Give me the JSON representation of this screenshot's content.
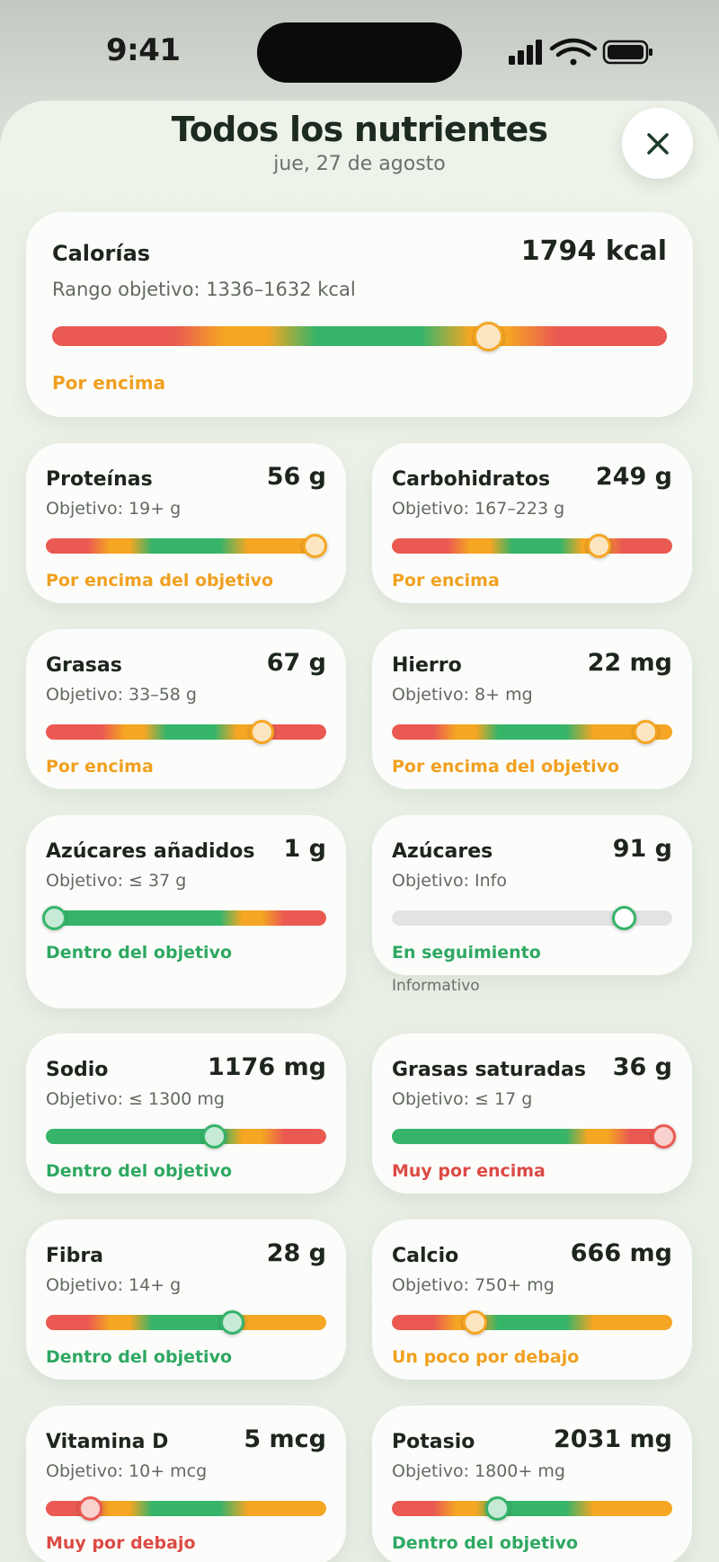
{
  "status_bar": {
    "time": "9:41"
  },
  "header": {
    "title": "Todos los nutrientes",
    "date": "jue, 27 de agosto"
  },
  "colors": {
    "red": "#ea5a52",
    "orange": "#f5a623",
    "green": "#35b46a",
    "grey": "#e3e3e3",
    "status_green": "#2fa862",
    "status_orange": "#f0a020",
    "status_red": "#dd4a44"
  },
  "calories": {
    "name": "Calorías",
    "value": "1794 kcal",
    "target": "Rango objetivo: 1336–1632 kcal",
    "status": "Por encima",
    "status_tone": "orange",
    "gradient": "range",
    "position": 0.71
  },
  "nutrients": [
    {
      "name": "Proteínas",
      "value": "56 g",
      "target": "Objetivo: 19+ g",
      "status": "Por encima del objetivo",
      "status_tone": "orange",
      "gradient": "min",
      "position": 0.96
    },
    {
      "name": "Carbohidratos",
      "value": "249 g",
      "target": "Objetivo: 167–223 g",
      "status": "Por encima",
      "status_tone": "orange",
      "gradient": "range",
      "position": 0.74
    },
    {
      "name": "Grasas",
      "value": "67 g",
      "target": "Objetivo: 33–58 g",
      "status": "Por encima",
      "status_tone": "orange",
      "gradient": "range",
      "position": 0.77
    },
    {
      "name": "Hierro",
      "value": "22 mg",
      "target": "Objetivo: 8+ mg",
      "status": "Por encima del objetivo",
      "status_tone": "orange",
      "gradient": "min",
      "position": 0.905
    },
    {
      "name": "Azúcares añadidos",
      "value": "1 g",
      "target": "Objetivo: ≤ 37 g",
      "status": "Dentro del objetivo",
      "status_tone": "green",
      "gradient": "max",
      "position": 0.015
    },
    {
      "name": "Azúcares",
      "value": "91 g",
      "target": "Objetivo: Info",
      "status": "En seguimiento",
      "status_tone": "green",
      "gradient": "info",
      "position": 0.83,
      "note": "Informativo"
    },
    {
      "name": "Sodio",
      "value": "1176 mg",
      "target": "Objetivo: ≤ 1300 mg",
      "status": "Dentro del objetivo",
      "status_tone": "green",
      "gradient": "max",
      "position": 0.6
    },
    {
      "name": "Grasas saturadas",
      "value": "36 g",
      "target": "Objetivo: ≤ 17 g",
      "status": "Muy por encima",
      "status_tone": "red",
      "gradient": "max",
      "position": 0.995
    },
    {
      "name": "Fibra",
      "value": "28 g",
      "target": "Objetivo: 14+ g",
      "status": "Dentro del objetivo",
      "status_tone": "green",
      "gradient": "min",
      "position": 0.665
    },
    {
      "name": "Calcio",
      "value": "666 mg",
      "target": "Objetivo: 750+ mg",
      "status": "Un poco por debajo",
      "status_tone": "orange",
      "gradient": "min",
      "position": 0.295
    },
    {
      "name": "Vitamina D",
      "value": "5 mcg",
      "target": "Objetivo: 10+ mcg",
      "status": "Muy por debajo",
      "status_tone": "red",
      "gradient": "min",
      "position": 0.16
    },
    {
      "name": "Potasio",
      "value": "2031 mg",
      "target": "Objetivo: 1800+ mg",
      "status": "Dentro del objetivo",
      "status_tone": "green",
      "gradient": "min",
      "position": 0.375
    }
  ]
}
